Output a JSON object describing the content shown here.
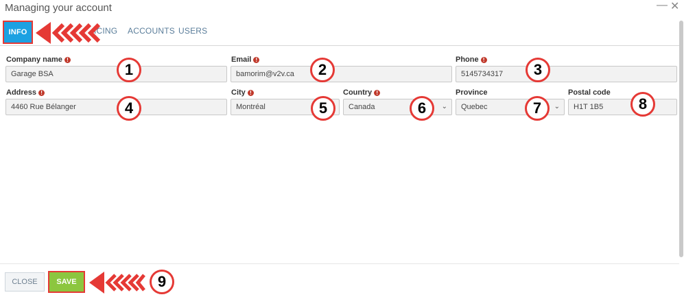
{
  "window": {
    "title": "Managing your account",
    "minimize": "—",
    "close": "✕"
  },
  "tabs": [
    {
      "label": "INFO",
      "active": true
    },
    {
      "label": "ICING"
    },
    {
      "label": "ACCOUNTS"
    },
    {
      "label": "USERS"
    }
  ],
  "form": {
    "company_name": {
      "label": "Company name",
      "value": "Garage BSA",
      "required": true
    },
    "email": {
      "label": "Email",
      "value": "bamorim@v2v.ca",
      "required": true
    },
    "phone": {
      "label": "Phone",
      "value": "5145734317",
      "required": true
    },
    "address": {
      "label": "Address",
      "value": "4460 Rue Bélanger",
      "required": true
    },
    "city": {
      "label": "City",
      "value": "Montréal",
      "required": true
    },
    "country": {
      "label": "Country",
      "value": "Canada",
      "required": true
    },
    "province": {
      "label": "Province",
      "value": "Quebec",
      "required": false
    },
    "postal_code": {
      "label": "Postal code",
      "value": "H1T 1B5",
      "required": false
    }
  },
  "callouts": [
    "1",
    "2",
    "3",
    "4",
    "5",
    "6",
    "7",
    "8",
    "9"
  ],
  "footer": {
    "close_label": "CLOSE",
    "save_label": "SAVE"
  },
  "icons": {
    "required": "exclamation-icon",
    "select": "chevron-down-icon",
    "arrow": "red-arrow-icon"
  },
  "colors": {
    "accent": "#1ba1e2",
    "save": "#8cc63f",
    "annotation": "#e53935",
    "required": "#c0392b"
  }
}
